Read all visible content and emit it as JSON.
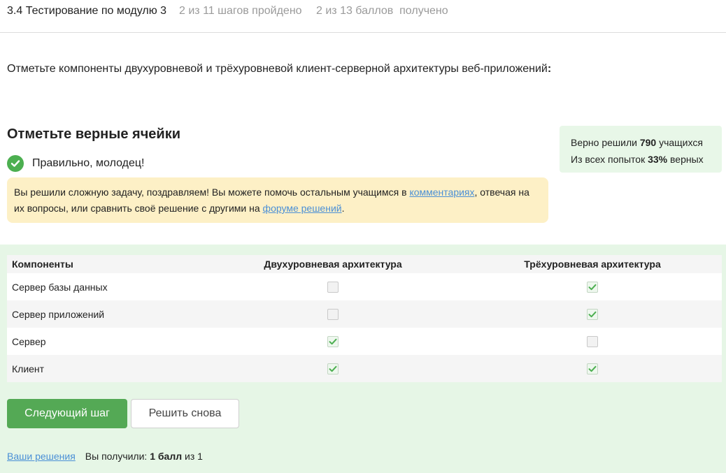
{
  "header": {
    "lesson_title": "3.4 Тестирование по модулю 3",
    "steps_progress": "2 из 11 шагов пройдено",
    "points_progress": "2 из 13 баллов  получено"
  },
  "question": {
    "text": "Отметьте компоненты двухуровневой и трёхуровневой клиент-серверной архитектуры веб-приложений",
    "colon": ":"
  },
  "quiz": {
    "title": "Отметьте верные ячейки",
    "result_text": "Правильно, молодец!"
  },
  "notice": {
    "part1": "Вы решили сложную задачу, поздравляем! Вы можете помочь остальным учащимся в ",
    "link_comments": "комментариях",
    "part2": ", отвечая на их вопросы, или сравнить своё решение с другими на ",
    "link_forum": "форуме решений",
    "part3": "."
  },
  "stats": {
    "solved_prefix": "Верно решили ",
    "solved_count": "790",
    "solved_suffix": " учащихся",
    "attempts_prefix": "Из всех попыток ",
    "attempts_percent": "33%",
    "attempts_suffix": " верных"
  },
  "matrix": {
    "headers": [
      "Компоненты",
      "Двухуровневая архитектура",
      "Трёхуровневая архитектура"
    ],
    "rows": [
      {
        "label": "Сервер базы данных",
        "two_tier": false,
        "three_tier": true
      },
      {
        "label": "Сервер приложений",
        "two_tier": false,
        "three_tier": true
      },
      {
        "label": "Сервер",
        "two_tier": true,
        "three_tier": false
      },
      {
        "label": "Клиент",
        "two_tier": true,
        "three_tier": true
      }
    ]
  },
  "actions": {
    "next_label": "Следующий шаг",
    "retry_label": "Решить снова"
  },
  "footer": {
    "your_solutions": "Ваши решения",
    "got_prefix": "Вы получили: ",
    "got_points": "1 балл",
    "got_suffix": " из 1"
  },
  "colors": {
    "accent_green": "#54a955",
    "check_green": "#4caf50",
    "link_blue": "#4a8fd6",
    "notice_bg": "#fdf0c6",
    "stats_bg": "#e8f7e8",
    "answer_area_bg": "#e6f6e6"
  },
  "icons": {
    "result": "check-circle-icon",
    "cell_checked": "checkmark-icon"
  }
}
